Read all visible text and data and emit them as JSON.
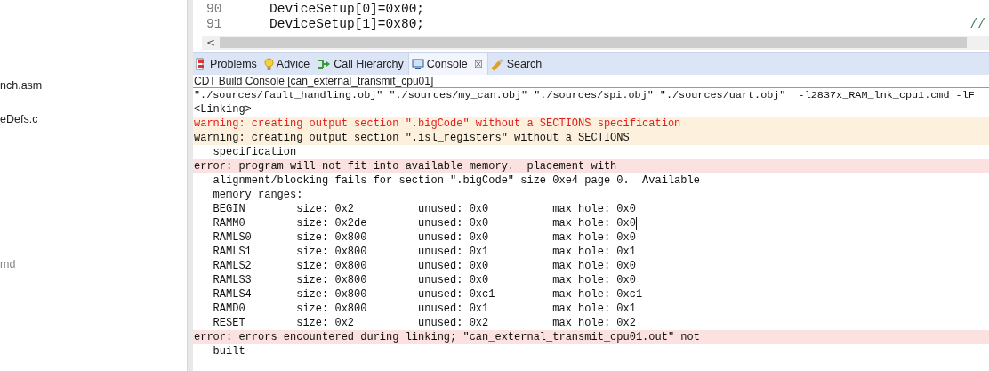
{
  "project_explorer": {
    "items": [
      {
        "label": "nch.asm",
        "dimmed": false
      },
      {
        "label": "eDefs.c",
        "dimmed": false
      },
      {
        "label": "md",
        "dimmed": true
      }
    ]
  },
  "editor": {
    "lines": [
      {
        "number": "90",
        "code": "DeviceSetup[0]=0x00;"
      },
      {
        "number": "91",
        "code": "DeviceSetup[1]=0x80;",
        "comment": "//"
      }
    ],
    "scroll_left": "<"
  },
  "tabs": [
    {
      "label": "Problems",
      "selected": false
    },
    {
      "label": "Advice",
      "selected": false
    },
    {
      "label": "Call Hierarchy",
      "selected": false
    },
    {
      "label": "Console",
      "selected": true,
      "close": "☒"
    },
    {
      "label": "Search",
      "selected": false
    }
  ],
  "console": {
    "title": "CDT Build Console [can_external_transmit_cpu01]",
    "lines": [
      {
        "kind": "plain",
        "text": "\"./sources/fault_handling.obj\" \"./sources/my_can.obj\" \"./sources/spi.obj\" \"./sources/uart.obj\"  -l2837x_RAM_lnk_cpu1.cmd -lF",
        "caret": false
      },
      {
        "kind": "plain",
        "text": "<Linking>",
        "caret": false
      },
      {
        "kind": "warning-current",
        "text": "warning: creating output section \".bigCode\" without a SECTIONS specification",
        "caret": false
      },
      {
        "kind": "warning",
        "text": "warning: creating output section \".isl_registers\" without a SECTIONS",
        "caret": false
      },
      {
        "kind": "plain",
        "text": "   specification",
        "caret": false
      },
      {
        "kind": "error",
        "text": "error: program will not fit into available memory.  placement with",
        "caret": false
      },
      {
        "kind": "plain",
        "text": "   alignment/blocking fails for section \".bigCode\" size 0xe4 page 0.  Available",
        "caret": false
      },
      {
        "kind": "plain",
        "text": "   memory ranges:",
        "caret": false
      },
      {
        "kind": "plain",
        "text": "   BEGIN        size: 0x2          unused: 0x0          max hole: 0x0",
        "caret": false
      },
      {
        "kind": "plain",
        "text": "   RAMM0        size: 0x2de        unused: 0x0          max hole: 0x0",
        "caret": true
      },
      {
        "kind": "plain",
        "text": "   RAMLS0       size: 0x800        unused: 0x0          max hole: 0x0",
        "caret": false
      },
      {
        "kind": "plain",
        "text": "   RAMLS1       size: 0x800        unused: 0x1          max hole: 0x1",
        "caret": false
      },
      {
        "kind": "plain",
        "text": "   RAMLS2       size: 0x800        unused: 0x0          max hole: 0x0",
        "caret": false
      },
      {
        "kind": "plain",
        "text": "   RAMLS3       size: 0x800        unused: 0x0          max hole: 0x0",
        "caret": false
      },
      {
        "kind": "plain",
        "text": "   RAMLS4       size: 0x800        unused: 0xc1         max hole: 0xc1",
        "caret": false
      },
      {
        "kind": "plain",
        "text": "   RAMD0        size: 0x800        unused: 0x1          max hole: 0x1",
        "caret": false
      },
      {
        "kind": "plain",
        "text": "   RESET        size: 0x2          unused: 0x2          max hole: 0x2",
        "caret": false
      },
      {
        "kind": "error",
        "text": "error: errors encountered during linking; \"can_external_transmit_cpu01.out\" not",
        "caret": false
      },
      {
        "kind": "plain",
        "text": "   built",
        "caret": false
      }
    ]
  }
}
